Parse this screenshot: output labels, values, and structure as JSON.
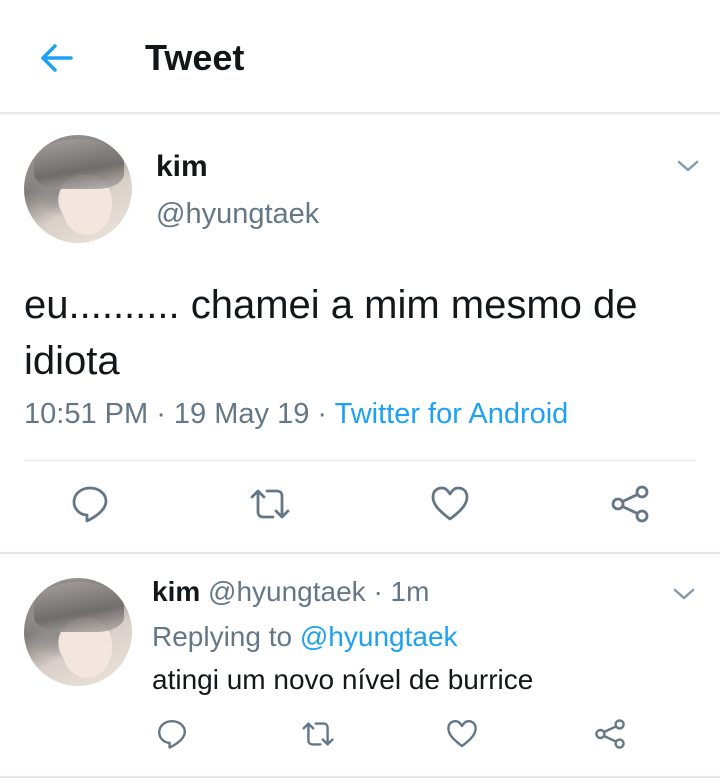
{
  "header": {
    "title": "Tweet",
    "back_icon": "arrow-left-icon"
  },
  "colors": {
    "accent": "#1da1f2",
    "text": "#14171a",
    "muted": "#657786",
    "divider": "#e1e8ed"
  },
  "tweet": {
    "name": "kim",
    "handle": "@hyungtaek",
    "text": "eu.......... chamei a mim mesmo de idiota",
    "time": "10:51 PM",
    "sep1": " · ",
    "date": "19 May 19",
    "sep2": " · ",
    "source": "Twitter for Android"
  },
  "reply": {
    "name": "kim",
    "handle": "@hyungtaek",
    "age": " · 1m",
    "replying_prefix": "Replying to ",
    "replying_to": "@hyungtaek",
    "text": "atingi um novo nível de burrice"
  },
  "actions": [
    "reply-icon",
    "retweet-icon",
    "like-icon",
    "share-icon"
  ]
}
